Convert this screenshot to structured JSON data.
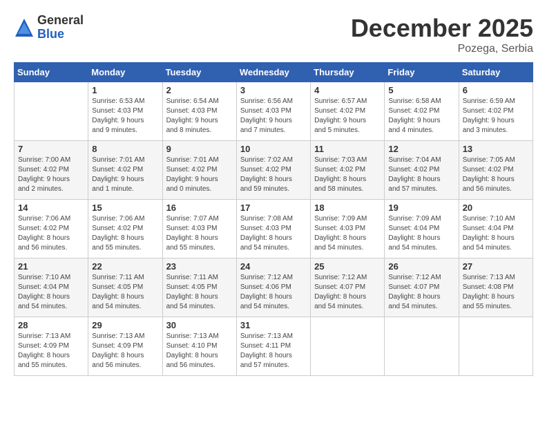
{
  "header": {
    "logo_general": "General",
    "logo_blue": "Blue",
    "month_title": "December 2025",
    "location": "Pozega, Serbia"
  },
  "days_of_week": [
    "Sunday",
    "Monday",
    "Tuesday",
    "Wednesday",
    "Thursday",
    "Friday",
    "Saturday"
  ],
  "weeks": [
    [
      {
        "num": "",
        "info": ""
      },
      {
        "num": "1",
        "info": "Sunrise: 6:53 AM\nSunset: 4:03 PM\nDaylight: 9 hours\nand 9 minutes."
      },
      {
        "num": "2",
        "info": "Sunrise: 6:54 AM\nSunset: 4:03 PM\nDaylight: 9 hours\nand 8 minutes."
      },
      {
        "num": "3",
        "info": "Sunrise: 6:56 AM\nSunset: 4:03 PM\nDaylight: 9 hours\nand 7 minutes."
      },
      {
        "num": "4",
        "info": "Sunrise: 6:57 AM\nSunset: 4:02 PM\nDaylight: 9 hours\nand 5 minutes."
      },
      {
        "num": "5",
        "info": "Sunrise: 6:58 AM\nSunset: 4:02 PM\nDaylight: 9 hours\nand 4 minutes."
      },
      {
        "num": "6",
        "info": "Sunrise: 6:59 AM\nSunset: 4:02 PM\nDaylight: 9 hours\nand 3 minutes."
      }
    ],
    [
      {
        "num": "7",
        "info": "Sunrise: 7:00 AM\nSunset: 4:02 PM\nDaylight: 9 hours\nand 2 minutes."
      },
      {
        "num": "8",
        "info": "Sunrise: 7:01 AM\nSunset: 4:02 PM\nDaylight: 9 hours\nand 1 minute."
      },
      {
        "num": "9",
        "info": "Sunrise: 7:01 AM\nSunset: 4:02 PM\nDaylight: 9 hours\nand 0 minutes."
      },
      {
        "num": "10",
        "info": "Sunrise: 7:02 AM\nSunset: 4:02 PM\nDaylight: 8 hours\nand 59 minutes."
      },
      {
        "num": "11",
        "info": "Sunrise: 7:03 AM\nSunset: 4:02 PM\nDaylight: 8 hours\nand 58 minutes."
      },
      {
        "num": "12",
        "info": "Sunrise: 7:04 AM\nSunset: 4:02 PM\nDaylight: 8 hours\nand 57 minutes."
      },
      {
        "num": "13",
        "info": "Sunrise: 7:05 AM\nSunset: 4:02 PM\nDaylight: 8 hours\nand 56 minutes."
      }
    ],
    [
      {
        "num": "14",
        "info": "Sunrise: 7:06 AM\nSunset: 4:02 PM\nDaylight: 8 hours\nand 56 minutes."
      },
      {
        "num": "15",
        "info": "Sunrise: 7:06 AM\nSunset: 4:02 PM\nDaylight: 8 hours\nand 55 minutes."
      },
      {
        "num": "16",
        "info": "Sunrise: 7:07 AM\nSunset: 4:03 PM\nDaylight: 8 hours\nand 55 minutes."
      },
      {
        "num": "17",
        "info": "Sunrise: 7:08 AM\nSunset: 4:03 PM\nDaylight: 8 hours\nand 54 minutes."
      },
      {
        "num": "18",
        "info": "Sunrise: 7:09 AM\nSunset: 4:03 PM\nDaylight: 8 hours\nand 54 minutes."
      },
      {
        "num": "19",
        "info": "Sunrise: 7:09 AM\nSunset: 4:04 PM\nDaylight: 8 hours\nand 54 minutes."
      },
      {
        "num": "20",
        "info": "Sunrise: 7:10 AM\nSunset: 4:04 PM\nDaylight: 8 hours\nand 54 minutes."
      }
    ],
    [
      {
        "num": "21",
        "info": "Sunrise: 7:10 AM\nSunset: 4:04 PM\nDaylight: 8 hours\nand 54 minutes."
      },
      {
        "num": "22",
        "info": "Sunrise: 7:11 AM\nSunset: 4:05 PM\nDaylight: 8 hours\nand 54 minutes."
      },
      {
        "num": "23",
        "info": "Sunrise: 7:11 AM\nSunset: 4:05 PM\nDaylight: 8 hours\nand 54 minutes."
      },
      {
        "num": "24",
        "info": "Sunrise: 7:12 AM\nSunset: 4:06 PM\nDaylight: 8 hours\nand 54 minutes."
      },
      {
        "num": "25",
        "info": "Sunrise: 7:12 AM\nSunset: 4:07 PM\nDaylight: 8 hours\nand 54 minutes."
      },
      {
        "num": "26",
        "info": "Sunrise: 7:12 AM\nSunset: 4:07 PM\nDaylight: 8 hours\nand 54 minutes."
      },
      {
        "num": "27",
        "info": "Sunrise: 7:13 AM\nSunset: 4:08 PM\nDaylight: 8 hours\nand 55 minutes."
      }
    ],
    [
      {
        "num": "28",
        "info": "Sunrise: 7:13 AM\nSunset: 4:09 PM\nDaylight: 8 hours\nand 55 minutes."
      },
      {
        "num": "29",
        "info": "Sunrise: 7:13 AM\nSunset: 4:09 PM\nDaylight: 8 hours\nand 56 minutes."
      },
      {
        "num": "30",
        "info": "Sunrise: 7:13 AM\nSunset: 4:10 PM\nDaylight: 8 hours\nand 56 minutes."
      },
      {
        "num": "31",
        "info": "Sunrise: 7:13 AM\nSunset: 4:11 PM\nDaylight: 8 hours\nand 57 minutes."
      },
      {
        "num": "",
        "info": ""
      },
      {
        "num": "",
        "info": ""
      },
      {
        "num": "",
        "info": ""
      }
    ]
  ]
}
